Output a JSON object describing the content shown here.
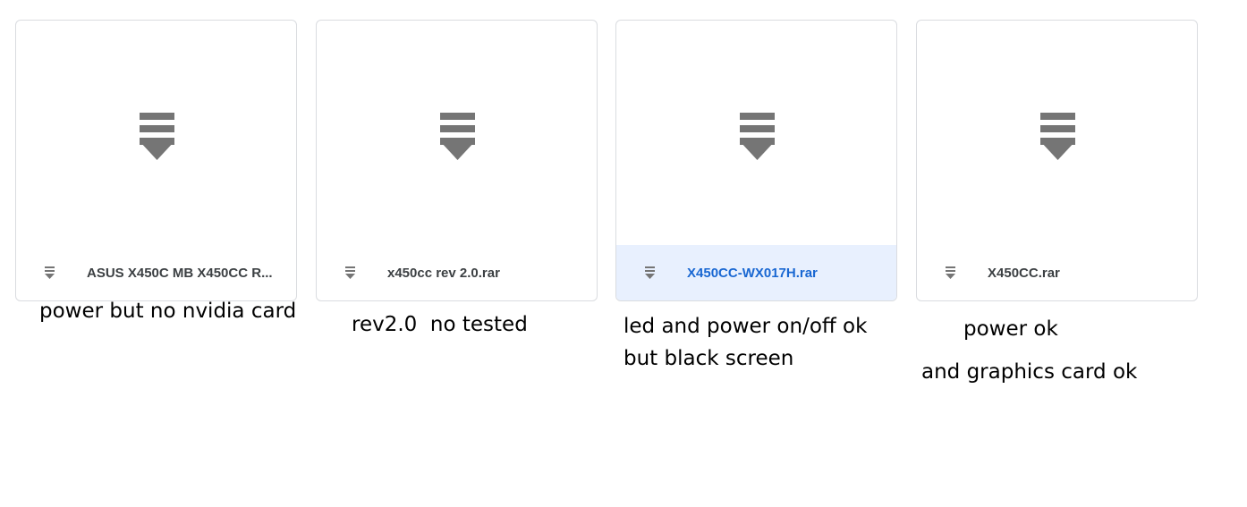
{
  "files": [
    {
      "name": "ASUS X450C MB X450CC R...",
      "icon": "download-icon",
      "selected": false
    },
    {
      "name": "x450cc rev 2.0.rar",
      "icon": "download-icon",
      "selected": false
    },
    {
      "name": "X450CC-WX017H.rar",
      "icon": "download-icon",
      "selected": true
    },
    {
      "name": "X450CC.rar",
      "icon": "download-icon",
      "selected": false
    }
  ],
  "annotations": {
    "card1": "power but no nvidia card",
    "card2": "rev2.0  no tested",
    "card3_line1": "led and power on/off ok",
    "card3_line2": "but black screen",
    "card4_line1": "power ok",
    "card4_line2": "and graphics card ok"
  },
  "colors": {
    "icon": "#757575",
    "selected_bg": "#e8f0fe",
    "selected_text": "#1967d2",
    "text": "#3c4043",
    "border": "#dadce0"
  }
}
